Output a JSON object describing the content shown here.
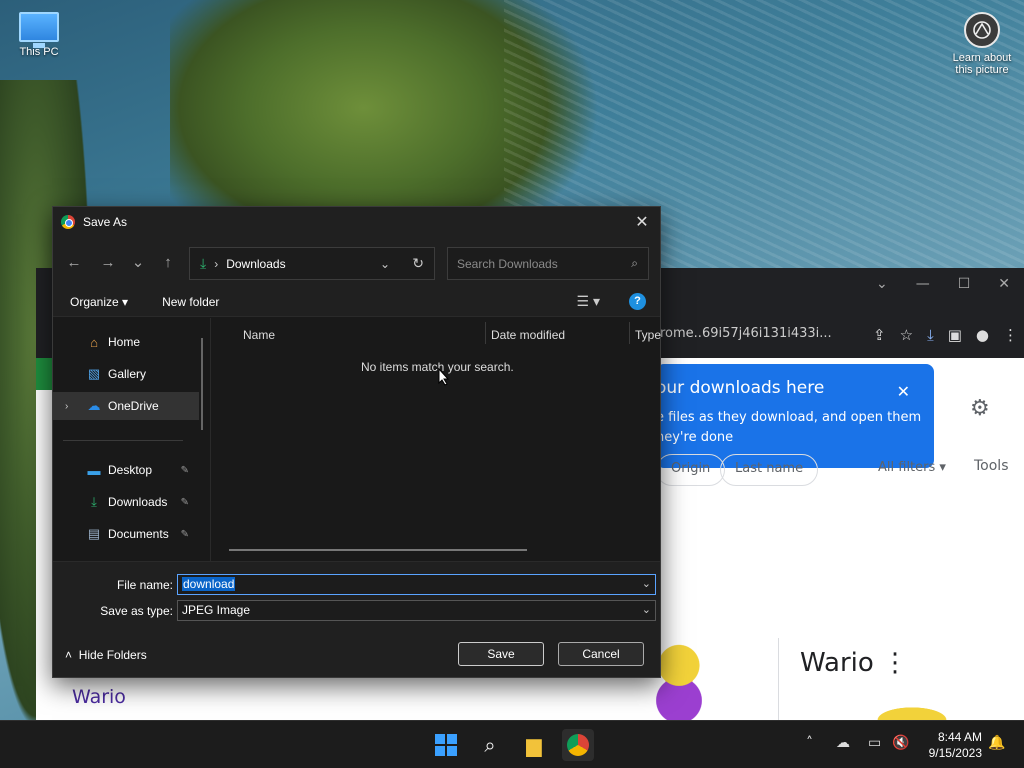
{
  "desktop": {
    "this_pc_label": "This PC",
    "learn_label_1": "Learn about",
    "learn_label_2": "this picture"
  },
  "chrome": {
    "address": "rome..69i57j46i131i433i...",
    "popup_title": "our downloads here",
    "popup_line1": "e files as they download, and open them",
    "popup_line2": "hey're done",
    "chip_origin": "Origin",
    "chip_lastname": "Last name",
    "chip_allfilters": "All filters ▾",
    "tools": "Tools",
    "wario_title": "Wario",
    "wario_link": "Wario"
  },
  "dialog": {
    "title": "Save As",
    "path_folder": "Downloads",
    "search_placeholder": "Search Downloads",
    "organize": "Organize ▾",
    "new_folder": "New folder",
    "nav": [
      {
        "label": "Home"
      },
      {
        "label": "Gallery"
      },
      {
        "label": "OneDrive"
      },
      {
        "label": "Desktop"
      },
      {
        "label": "Downloads"
      },
      {
        "label": "Documents"
      }
    ],
    "columns": [
      "Name",
      "Date modified",
      "Type"
    ],
    "empty_message": "No items match your search.",
    "file_name_label": "File name:",
    "file_name_value": "download",
    "save_type_label": "Save as type:",
    "save_type_value": "JPEG Image",
    "hide_folders": "Hide Folders",
    "save_button": "Save",
    "cancel_button": "Cancel"
  },
  "taskbar": {
    "time": "8:44 AM",
    "date": "9/15/2023"
  },
  "colors": {
    "accent": "#1a73e8",
    "dialog_bg": "#191919",
    "selection": "#0a64c8"
  }
}
